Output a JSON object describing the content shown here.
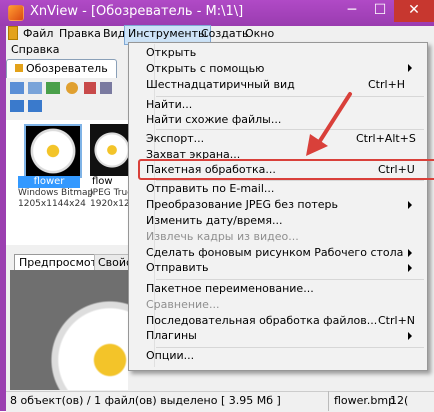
{
  "window": {
    "title": "XnView - [Обозреватель - M:\\1\\]",
    "minimize": "─",
    "maximize": "☐",
    "close": "✕"
  },
  "menubar": {
    "items": [
      "Файл",
      "Правка",
      "Вид",
      "Инструменты",
      "Создать",
      "Окно"
    ],
    "second_row": "Справка",
    "active": "Инструменты"
  },
  "tabs": {
    "browser": "Обозреватель"
  },
  "thumbnails": [
    {
      "name": "flower",
      "type": "Windows Bitmap",
      "size": "1205x1144x24",
      "selected": true
    },
    {
      "name": "flow",
      "type": "JPEG True",
      "size": "1920x12"
    }
  ],
  "preview_tabs": {
    "preview": "Предпросмотр",
    "props": "Свойст"
  },
  "statusbar": {
    "text": "8 объект(ов) / 1 файл(ов) выделено [ 3.95 Мб ]",
    "file": "flower.bmp",
    "extra": "12("
  },
  "menu": {
    "items": [
      {
        "label": "Открыть"
      },
      {
        "label": "Открыть с помощью",
        "submenu": true
      },
      {
        "label": "Шестнадцатиричный вид",
        "shortcut": "Ctrl+H"
      },
      {
        "label": "Найти..."
      },
      {
        "label": "Найти схожие файлы..."
      },
      {
        "label": "Экспорт...",
        "shortcut": "Ctrl+Alt+S"
      },
      {
        "label": "Захват экрана..."
      },
      {
        "label": "Пакетная обработка...",
        "shortcut": "Ctrl+U",
        "highlighted": true
      },
      {
        "label": "Отправить по E-mail..."
      },
      {
        "label": "Преобразование JPEG без потерь",
        "submenu": true
      },
      {
        "label": "Изменить дату/время..."
      },
      {
        "label": "Извлечь кадры из видео...",
        "disabled": true
      },
      {
        "label": "Сделать фоновым рисунком Рабочего стола",
        "submenu": true
      },
      {
        "label": "Отправить",
        "submenu": true
      },
      {
        "label": "Пакетное переименование..."
      },
      {
        "label": "Сравнение...",
        "disabled": true
      },
      {
        "label": "Последовательная обработка файлов...",
        "shortcut": "Ctrl+N"
      },
      {
        "label": "Плагины",
        "submenu": true
      },
      {
        "label": "Опции..."
      }
    ]
  },
  "colors": {
    "titlebar": "#9b3fb0",
    "close": "#c7372f",
    "highlight_border": "#d9403a",
    "selection": "#3399ff"
  }
}
